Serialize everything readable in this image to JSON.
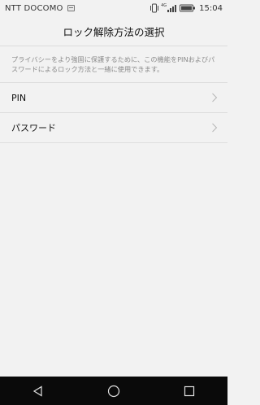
{
  "status_bar": {
    "carrier": "NTT DOCOMO",
    "network_type": "4G",
    "time": "15:04"
  },
  "header": {
    "title": "ロック解除方法の選択"
  },
  "description": "プライバシーをより強固に保護するために、この機能をPINおよびパスワードによるロック方法と一緒に使用できます。",
  "options": [
    {
      "label": "PIN",
      "icon": "chevron-right-icon"
    },
    {
      "label": "パスワード",
      "icon": "chevron-right-icon"
    }
  ],
  "nav_bar": {
    "back": "back-triangle-icon",
    "home": "home-circle-icon",
    "recents": "recents-square-icon"
  },
  "colors": {
    "background": "#f2f2f2",
    "divider": "#dedede",
    "description_text": "#8a8a8a",
    "nav_bar": "#0a0a0a"
  }
}
